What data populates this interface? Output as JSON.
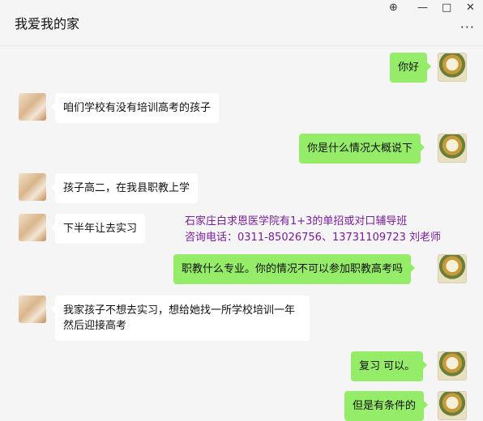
{
  "window": {
    "title": "我爱我的家",
    "controls": {
      "pin": "⊕",
      "minimize": "—",
      "maximize": "□",
      "close": "✕"
    },
    "more": "···"
  },
  "messages": [
    {
      "side": "right",
      "text": "你好"
    },
    {
      "side": "left",
      "text": "咱们学校有没有培训高考的孩子"
    },
    {
      "side": "right",
      "text": "你是什么情况大概说下"
    },
    {
      "side": "left",
      "text": "孩子高二，在我县职教上学"
    },
    {
      "side": "left",
      "text": "下半年让去实习"
    },
    {
      "side": "right",
      "text": "职教什么专业。你的情况不可以参加职教高考吗"
    },
    {
      "side": "left",
      "text": "我家孩子不想去实习，想给她找一所学校培训一年然后迎接高考"
    },
    {
      "side": "right",
      "text": "复习 可以。"
    },
    {
      "side": "right",
      "text": "但是有条件的"
    }
  ],
  "overlay": {
    "line1": "石家庄白求恩医学院有1+3的单招或对口辅导班",
    "line2": "咨询电话：0311-85026756、13731109723 刘老师"
  },
  "colors": {
    "my_bubble": "#95ec69",
    "their_bubble": "#ffffff",
    "overlay_text": "#7a1d9a"
  }
}
